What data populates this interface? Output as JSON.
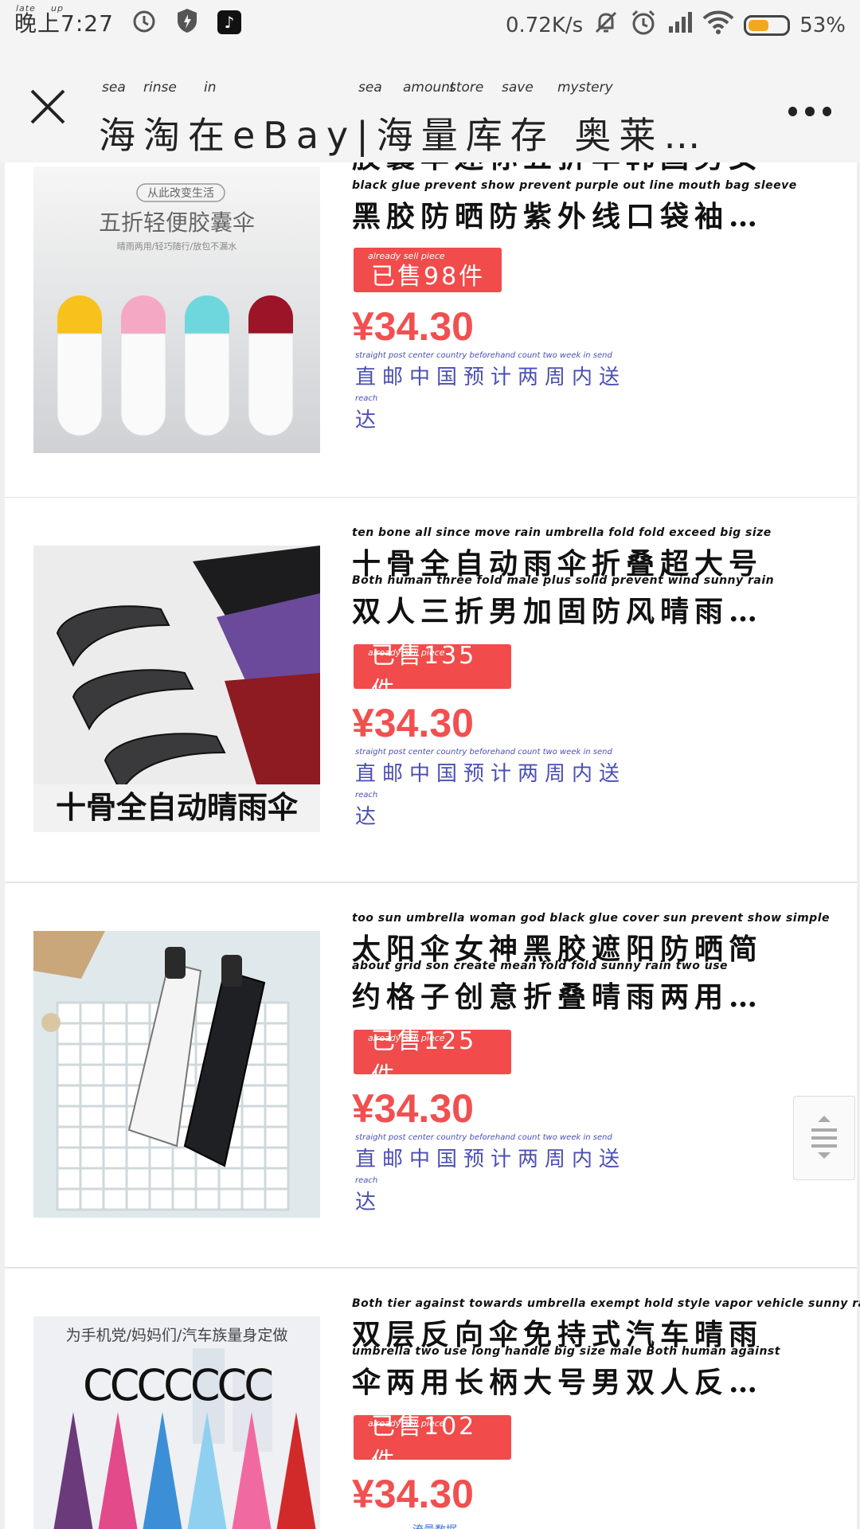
{
  "status_bar": {
    "time": "晚上7:27",
    "time_gloss_1": "late",
    "time_gloss_2": "up",
    "network_speed": "0.72K/s",
    "battery_pct": "53%",
    "battery_level": 0.53
  },
  "nav": {
    "title": "海淘在eBay|海量库存 奥莱…",
    "title_glosses": [
      "sea",
      "rinse",
      "in",
      "sea",
      "amount",
      "store",
      "save",
      "mystery"
    ]
  },
  "products": [
    {
      "title_line1_gloss": "",
      "title_line1": "胶囊伞迷你五折伞韩国男女",
      "title_line2_gloss": "black glue prevent show prevent purple out line mouth bag sleeve",
      "title_line2": "黑胶防晒防紫外线口袋袖…",
      "sold_gloss": "already  sell          piece",
      "sold_text": "已售98件",
      "price": "¥34.30",
      "ship_gloss": "straight post center country beforehand count two week in send",
      "ship_text": "直邮中国预计两周内送",
      "ship_gloss2": "reach",
      "ship_text2": "达",
      "image": {
        "badge": "从此改变生活",
        "headline": "五折轻便胶囊伞",
        "subline": "晴雨两用/轻巧随行/放包不漏水",
        "capsule_colors": [
          "#f8c21c",
          "#f5a8c4",
          "#6ed7de",
          "#9b1428"
        ]
      }
    },
    {
      "title_line1_gloss": "ten bone all since move rain umbrella fold fold exceed big size",
      "title_line1": "十骨全自动雨伞折叠超大号",
      "title_line2_gloss": "Both human three fold male plus solid prevent wind sunny rain",
      "title_line2": "双人三折男加固防风晴雨…",
      "sold_gloss": "already  sell           piece",
      "sold_text": "已售135件",
      "price": "¥34.30",
      "ship_gloss": "straight post center country beforehand count two week in send",
      "ship_text": "直邮中国预计两周内送",
      "ship_gloss2": "reach",
      "ship_text2": "达",
      "image": {
        "caption": "十骨全自动晴雨伞",
        "umbrella_colors": [
          "#1c1c1f",
          "#6b4a9b",
          "#8e1b22"
        ]
      }
    },
    {
      "title_line1_gloss": "too sun umbrella woman god black glue cover sun prevent show simple",
      "title_line1": "太阳伞女神黑胶遮阳防晒简",
      "title_line2_gloss": "about grid son create mean fold fold sunny rain two use",
      "title_line2": "约格子创意折叠晴雨两用…",
      "sold_gloss": "already  sell           piece",
      "sold_text": "已售125件",
      "price": "¥34.30",
      "ship_gloss": "straight post center country beforehand count two week in send",
      "ship_text": "直邮中国预计两周内送",
      "ship_gloss2": "reach",
      "ship_text2": "达",
      "image": {}
    },
    {
      "title_line1_gloss": "Both tier against towards umbrella exempt hold style vapor vehicle sunny rain",
      "title_line1": "双层反向伞免持式汽车晴雨",
      "title_line2_gloss": "umbrella two use long handle big size male Both human against",
      "title_line2": "伞两用长柄大号男双人反…",
      "sold_gloss": "already  sell           piece",
      "sold_text": "已售102件",
      "price": "¥34.30",
      "ship_gloss": "",
      "ship_text": "",
      "ship_gloss2": "",
      "ship_text2": "",
      "image": {
        "headline": "为手机党/妈妈们/汽车族量身定做",
        "hook_letters": "CCCCCCC",
        "canopy_colors": [
          "#6b3a7a",
          "#e24a8a",
          "#3c8fd6",
          "#8fd0f0",
          "#f06aa0",
          "#d22a2a"
        ]
      }
    }
  ],
  "bottom_watermark": "流量数据"
}
